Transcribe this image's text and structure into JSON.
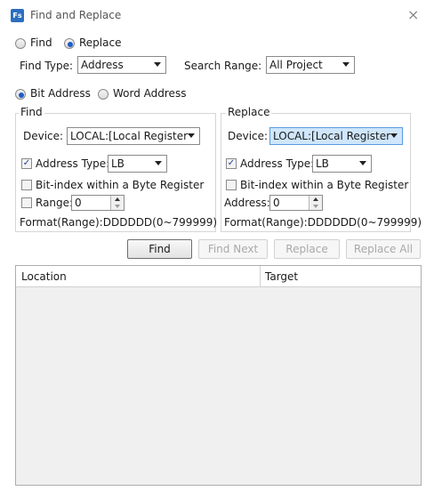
{
  "window": {
    "app_icon_text": "Fs",
    "title": "Find and Replace",
    "close_glyph": "×"
  },
  "mode": {
    "find_label": "Find",
    "replace_label": "Replace",
    "selected": "replace"
  },
  "filters": {
    "find_type_label": "Find Type:",
    "find_type_value": "Address",
    "search_range_label": "Search Range:",
    "search_range_value": "All Project"
  },
  "address_kind": {
    "bit_label": "Bit Address",
    "word_label": "Word Address",
    "selected": "bit"
  },
  "find_group": {
    "title": "Find",
    "device_label": "Device:",
    "device_value": "LOCAL:[Local Register",
    "address_type_label": "Address Type:",
    "address_type_value": "LB",
    "address_type_checked": true,
    "bit_index_label": "Bit-index within a Byte Register",
    "bit_index_checked": false,
    "range_label": "Range:",
    "range_value": "0",
    "range_checked": false,
    "format_text": "Format(Range):DDDDDD(0~799999)"
  },
  "replace_group": {
    "title": "Replace",
    "device_label": "Device:",
    "device_value": "LOCAL:[Local Register",
    "address_type_label": "Address Type:",
    "address_type_value": "LB",
    "address_type_checked": true,
    "bit_index_label": "Bit-index within a Byte Register",
    "bit_index_checked": false,
    "address_label": "Address:",
    "address_value": "0",
    "format_text": "Format(Range):DDDDDD(0~799999)"
  },
  "actions": {
    "find": "Find",
    "find_next": "Find Next",
    "replace": "Replace",
    "replace_all": "Replace All"
  },
  "results": {
    "columns": [
      "Location",
      "Target"
    ],
    "rows": []
  },
  "colors": {
    "accent": "#1f5cc8",
    "highlight_combo": "#cfe6fb"
  }
}
